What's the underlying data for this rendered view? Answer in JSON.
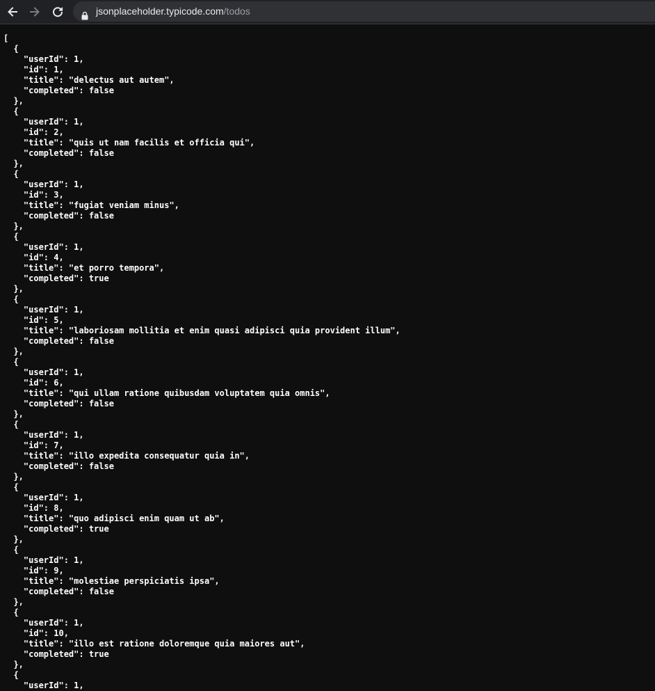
{
  "browser": {
    "url_host": "jsonplaceholder.typicode.com",
    "url_path": "/todos",
    "icons": [
      "back-arrow-icon",
      "forward-arrow-icon",
      "reload-icon",
      "lock-icon"
    ]
  },
  "page": {
    "json_text": "[\n  {\n    \"userId\": 1,\n    \"id\": 1,\n    \"title\": \"delectus aut autem\",\n    \"completed\": false\n  },\n  {\n    \"userId\": 1,\n    \"id\": 2,\n    \"title\": \"quis ut nam facilis et officia qui\",\n    \"completed\": false\n  },\n  {\n    \"userId\": 1,\n    \"id\": 3,\n    \"title\": \"fugiat veniam minus\",\n    \"completed\": false\n  },\n  {\n    \"userId\": 1,\n    \"id\": 4,\n    \"title\": \"et porro tempora\",\n    \"completed\": true\n  },\n  {\n    \"userId\": 1,\n    \"id\": 5,\n    \"title\": \"laboriosam mollitia et enim quasi adipisci quia provident illum\",\n    \"completed\": false\n  },\n  {\n    \"userId\": 1,\n    \"id\": 6,\n    \"title\": \"qui ullam ratione quibusdam voluptatem quia omnis\",\n    \"completed\": false\n  },\n  {\n    \"userId\": 1,\n    \"id\": 7,\n    \"title\": \"illo expedita consequatur quia in\",\n    \"completed\": false\n  },\n  {\n    \"userId\": 1,\n    \"id\": 8,\n    \"title\": \"quo adipisci enim quam ut ab\",\n    \"completed\": true\n  },\n  {\n    \"userId\": 1,\n    \"id\": 9,\n    \"title\": \"molestiae perspiciatis ipsa\",\n    \"completed\": false\n  },\n  {\n    \"userId\": 1,\n    \"id\": 10,\n    \"title\": \"illo est ratione doloremque quia maiores aut\",\n    \"completed\": true\n  },\n  {\n    \"userId\": 1,"
  },
  "colors": {
    "toolbar_bg": "#202124",
    "omnibox_bg": "#303134",
    "page_bg": "#0f0f0f",
    "text": "#ffffff"
  }
}
